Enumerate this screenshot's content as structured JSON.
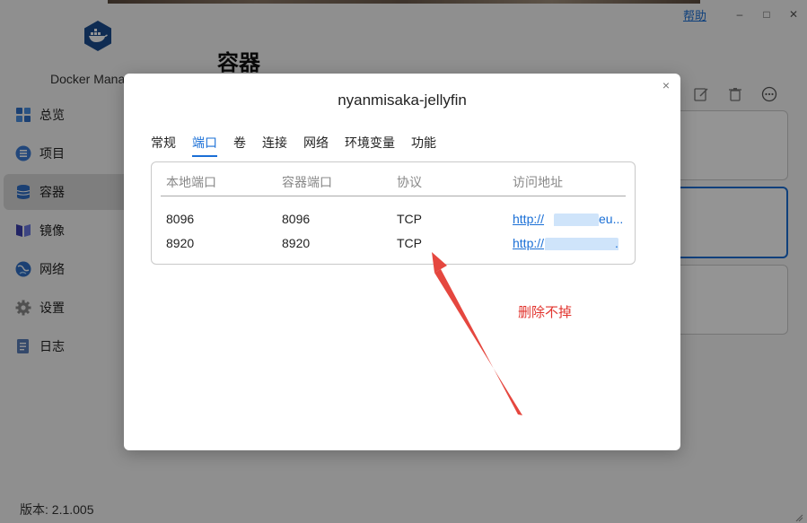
{
  "window": {
    "help_label": "帮助",
    "minimize": "–",
    "maximize": "□",
    "close": "✕"
  },
  "app": {
    "name": "Docker Mana",
    "version": "版本: 2.1.005"
  },
  "sidebar": {
    "items": [
      {
        "label": "总览",
        "icon": "dashboard-icon"
      },
      {
        "label": "项目",
        "icon": "list-icon"
      },
      {
        "label": "容器",
        "icon": "container-icon"
      },
      {
        "label": "镜像",
        "icon": "image-icon"
      },
      {
        "label": "网络",
        "icon": "globe-icon"
      },
      {
        "label": "设置",
        "icon": "gear-icon"
      },
      {
        "label": "日志",
        "icon": "log-icon"
      }
    ],
    "active": "容器"
  },
  "main": {
    "title": "容器"
  },
  "modal": {
    "title": "nyanmisaka-jellyfin",
    "close": "×",
    "tabs": [
      "常规",
      "端口",
      "卷",
      "连接",
      "网络",
      "环境变量",
      "功能"
    ],
    "active_tab": "端口",
    "table": {
      "headers": [
        "本地端口",
        "容器端口",
        "协议",
        "访问地址"
      ],
      "rows": [
        {
          "local": "8096",
          "container": "8096",
          "protocol": "TCP",
          "url": "http://",
          "url_tail": "eu..."
        },
        {
          "local": "8920",
          "container": "8920",
          "protocol": "TCP",
          "url": "http://",
          "url_tail": "."
        }
      ]
    }
  },
  "annotation": {
    "text": "删除不掉",
    "color": "#e2342e"
  },
  "colors": {
    "accent": "#1a6fd6",
    "annotation": "#e2342e"
  }
}
